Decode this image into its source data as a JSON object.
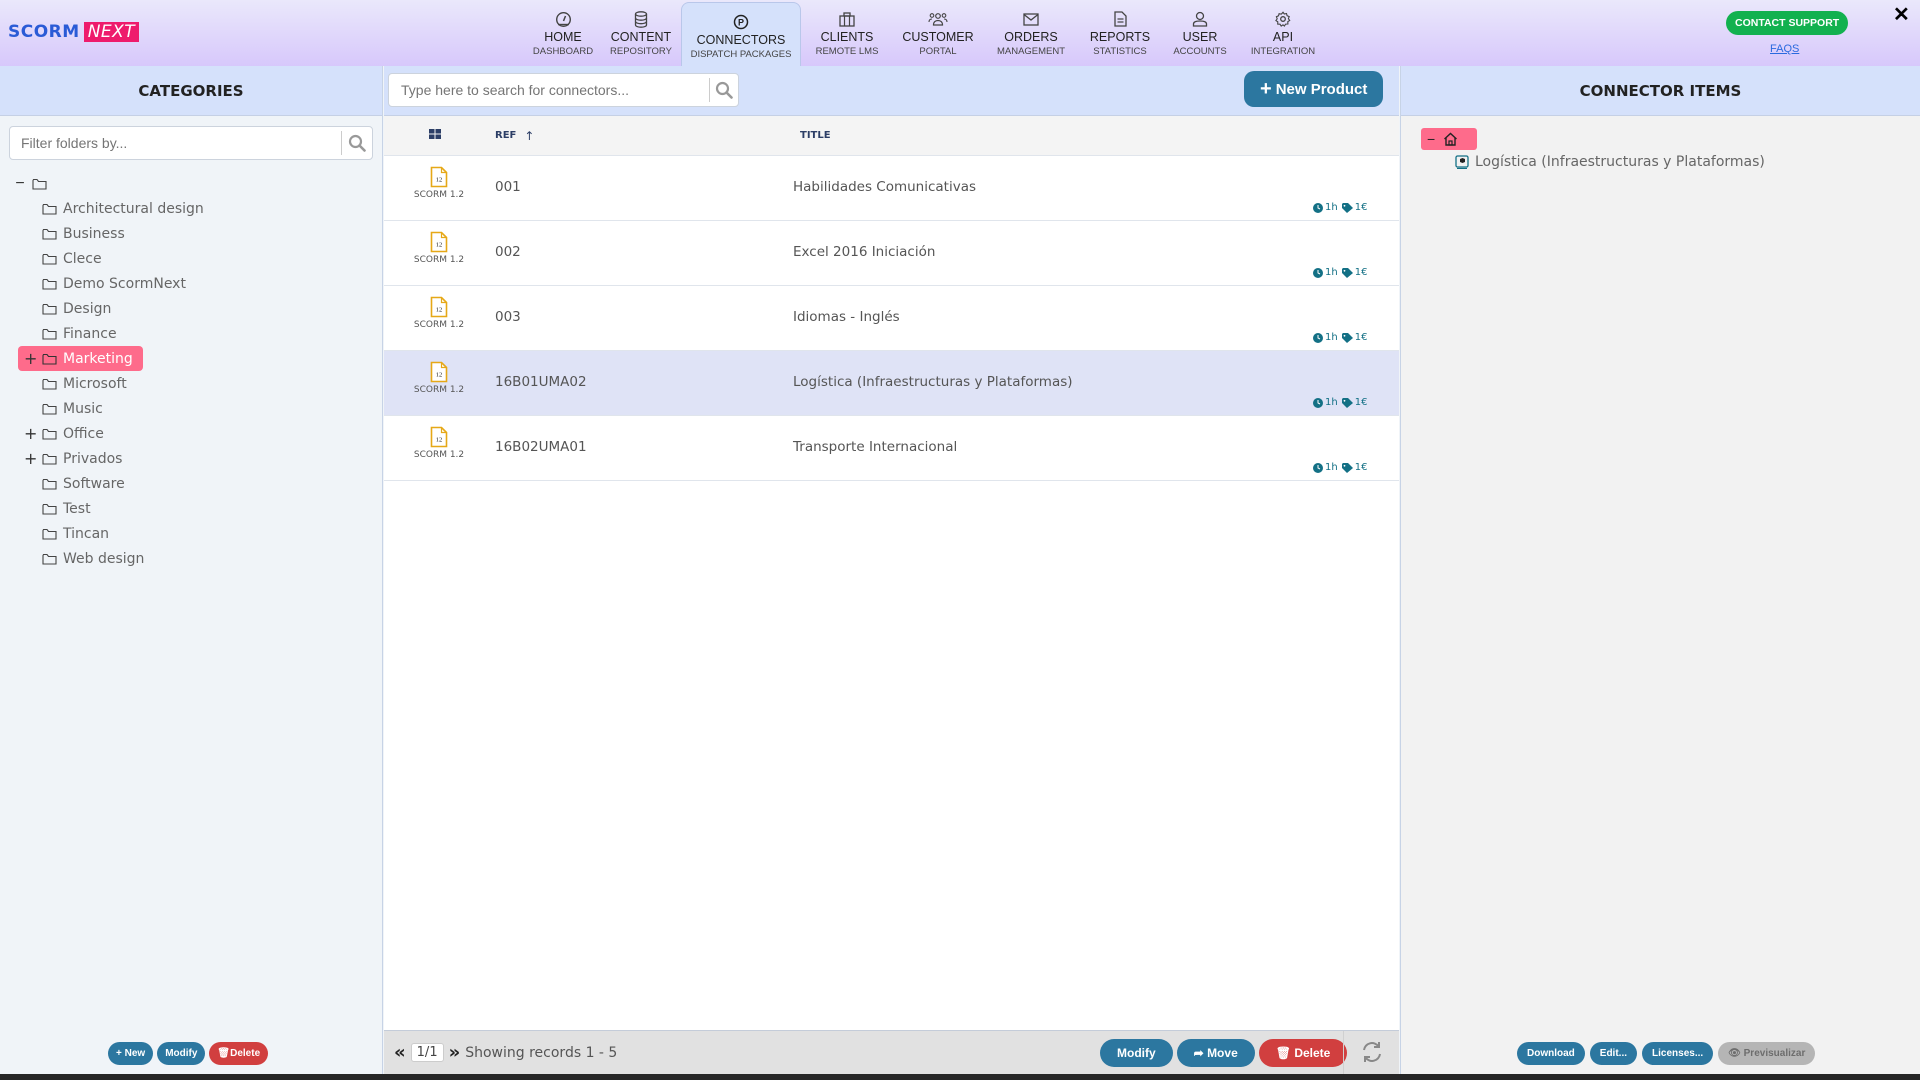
{
  "header": {
    "logo_part1": "SCORM",
    "logo_part2": "NEXT",
    "nav": [
      {
        "title": "HOME",
        "sub": "DASHBOARD",
        "icon": "gauge-icon"
      },
      {
        "title": "CONTENT",
        "sub": "REPOSITORY",
        "icon": "database-icon"
      },
      {
        "title": "CONNECTORS",
        "sub": "DISPATCH PACKAGES",
        "icon": "parking-circle-icon",
        "active": true
      },
      {
        "title": "CLIENTS",
        "sub": "REMOTE LMS",
        "icon": "briefcase-icon"
      },
      {
        "title": "CUSTOMER",
        "sub": "PORTAL",
        "icon": "users-icon"
      },
      {
        "title": "ORDERS",
        "sub": "MANAGEMENT",
        "icon": "envelope-icon"
      },
      {
        "title": "REPORTS",
        "sub": "STATISTICS",
        "icon": "document-icon"
      },
      {
        "title": "USER",
        "sub": "ACCOUNTS",
        "icon": "user-icon"
      },
      {
        "title": "API",
        "sub": "INTEGRATION",
        "icon": "gear-icon"
      }
    ],
    "support_label": "CONTACT SUPPORT",
    "faqs_label": "FAQS",
    "close_label": "✕"
  },
  "categories": {
    "title": "CATEGORIES",
    "filter_placeholder": "Filter folders by...",
    "items": [
      {
        "label": "Architectural design",
        "expandable": false
      },
      {
        "label": "Business",
        "expandable": false
      },
      {
        "label": "Clece",
        "expandable": false
      },
      {
        "label": "Demo ScormNext",
        "expandable": false
      },
      {
        "label": "Design",
        "expandable": false
      },
      {
        "label": "Finance",
        "expandable": false
      },
      {
        "label": "Marketing",
        "expandable": true,
        "selected": true
      },
      {
        "label": "Microsoft",
        "expandable": false
      },
      {
        "label": "Music",
        "expandable": false
      },
      {
        "label": "Office",
        "expandable": true
      },
      {
        "label": "Privados",
        "expandable": true
      },
      {
        "label": "Software",
        "expandable": false
      },
      {
        "label": "Test",
        "expandable": false
      },
      {
        "label": "Tincan",
        "expandable": false
      },
      {
        "label": "Web design",
        "expandable": false
      }
    ],
    "buttons": {
      "new": "New",
      "modify": "Modify",
      "delete": "Delete"
    }
  },
  "connectors": {
    "search_placeholder": "Type here to search for connectors...",
    "new_product_label": "New Product",
    "columns": {
      "ref": "REF",
      "title": "TITLE"
    },
    "rows": [
      {
        "type": "SCORM 1.2",
        "badge": "12",
        "ref": "001",
        "title": "Habilidades Comunicativas",
        "duration": "1h",
        "price": "1€"
      },
      {
        "type": "SCORM 1.2",
        "badge": "12",
        "ref": "002",
        "title": "Excel 2016 Iniciación",
        "duration": "1h",
        "price": "1€"
      },
      {
        "type": "SCORM 1.2",
        "badge": "12",
        "ref": "003",
        "title": "Idiomas - Inglés",
        "duration": "1h",
        "price": "1€"
      },
      {
        "type": "SCORM 1.2",
        "badge": "12",
        "ref": "16B01UMA02",
        "title": "Logística (Infraestructuras y Plataformas)",
        "duration": "1h",
        "price": "1€",
        "selected": true
      },
      {
        "type": "SCORM 1.2",
        "badge": "12",
        "ref": "16B02UMA01",
        "title": "Transporte Internacional",
        "duration": "1h",
        "price": "1€"
      }
    ],
    "pager": {
      "page": "1",
      "total": "1",
      "status": "Showing records 1 - 5"
    },
    "buttons": {
      "modify": "Modify",
      "move": "Move",
      "delete": "Delete"
    }
  },
  "connector_items": {
    "title": "CONNECTOR ITEMS",
    "items": [
      {
        "label": "Logística (Infraestructuras y Plataformas)"
      }
    ],
    "buttons": {
      "download": "Download",
      "edit": "Edit...",
      "licenses": "Licenses...",
      "preview": "Previsualizar"
    }
  },
  "colors": {
    "accent": "#2c77a0",
    "danger": "#d13f3f",
    "selected_folder": "#fe6b8b",
    "support_green": "#12b14f",
    "brand_pink": "#ee1b6c",
    "panel_header": "#d5e1fb"
  }
}
